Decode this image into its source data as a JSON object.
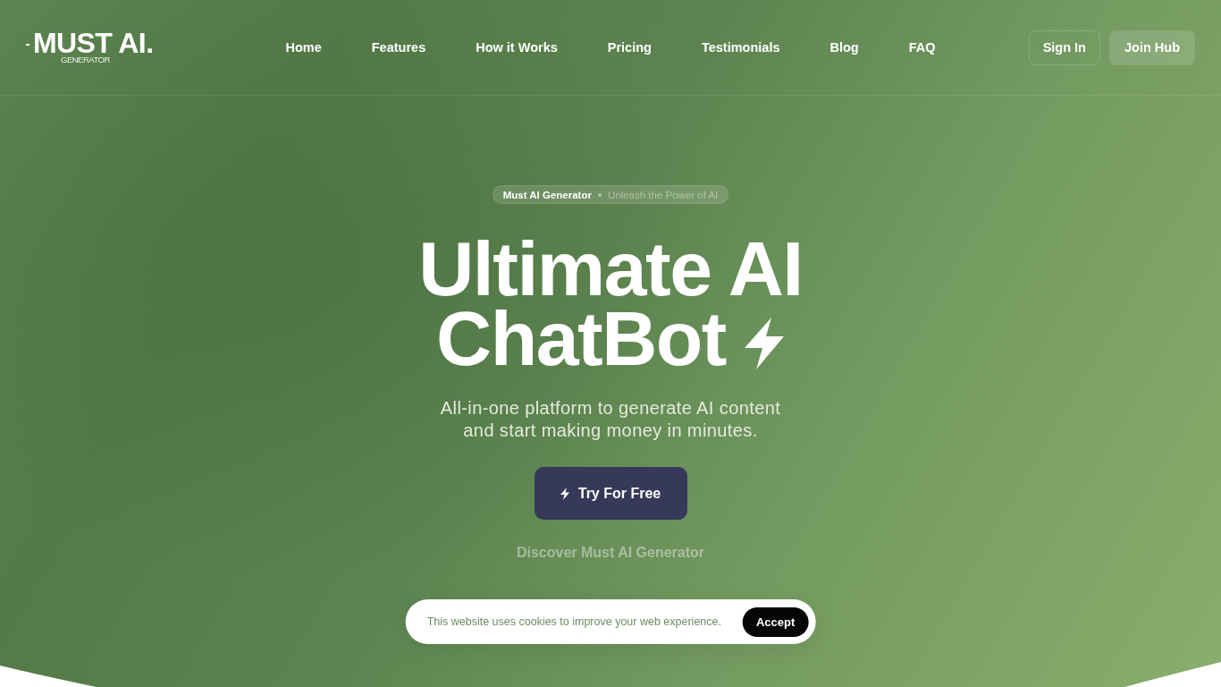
{
  "logo": {
    "wordmark": "MUST AI.",
    "tagline": "GENERATOR"
  },
  "nav": {
    "links": [
      "Home",
      "Features",
      "How it Works",
      "Pricing",
      "Testimonials",
      "Blog",
      "FAQ"
    ]
  },
  "actions": [
    {
      "label": "Sign In",
      "kind": "outline"
    },
    {
      "label": "Join Hub",
      "kind": "filled"
    }
  ],
  "hero": {
    "badge": {
      "name": "Must AI Generator",
      "tagline": "Unleash the Power of AI"
    },
    "headline": [
      "Ultimate AI",
      "ChatBot"
    ],
    "subtitle": "All-in-one platform to generate AI content and start making money in minutes.",
    "cta": "Try For Free",
    "link": "Discover Must AI Generator"
  },
  "cookie_banner": {
    "message": "This website uses cookies to improve your web experience.",
    "button": "Accept"
  }
}
